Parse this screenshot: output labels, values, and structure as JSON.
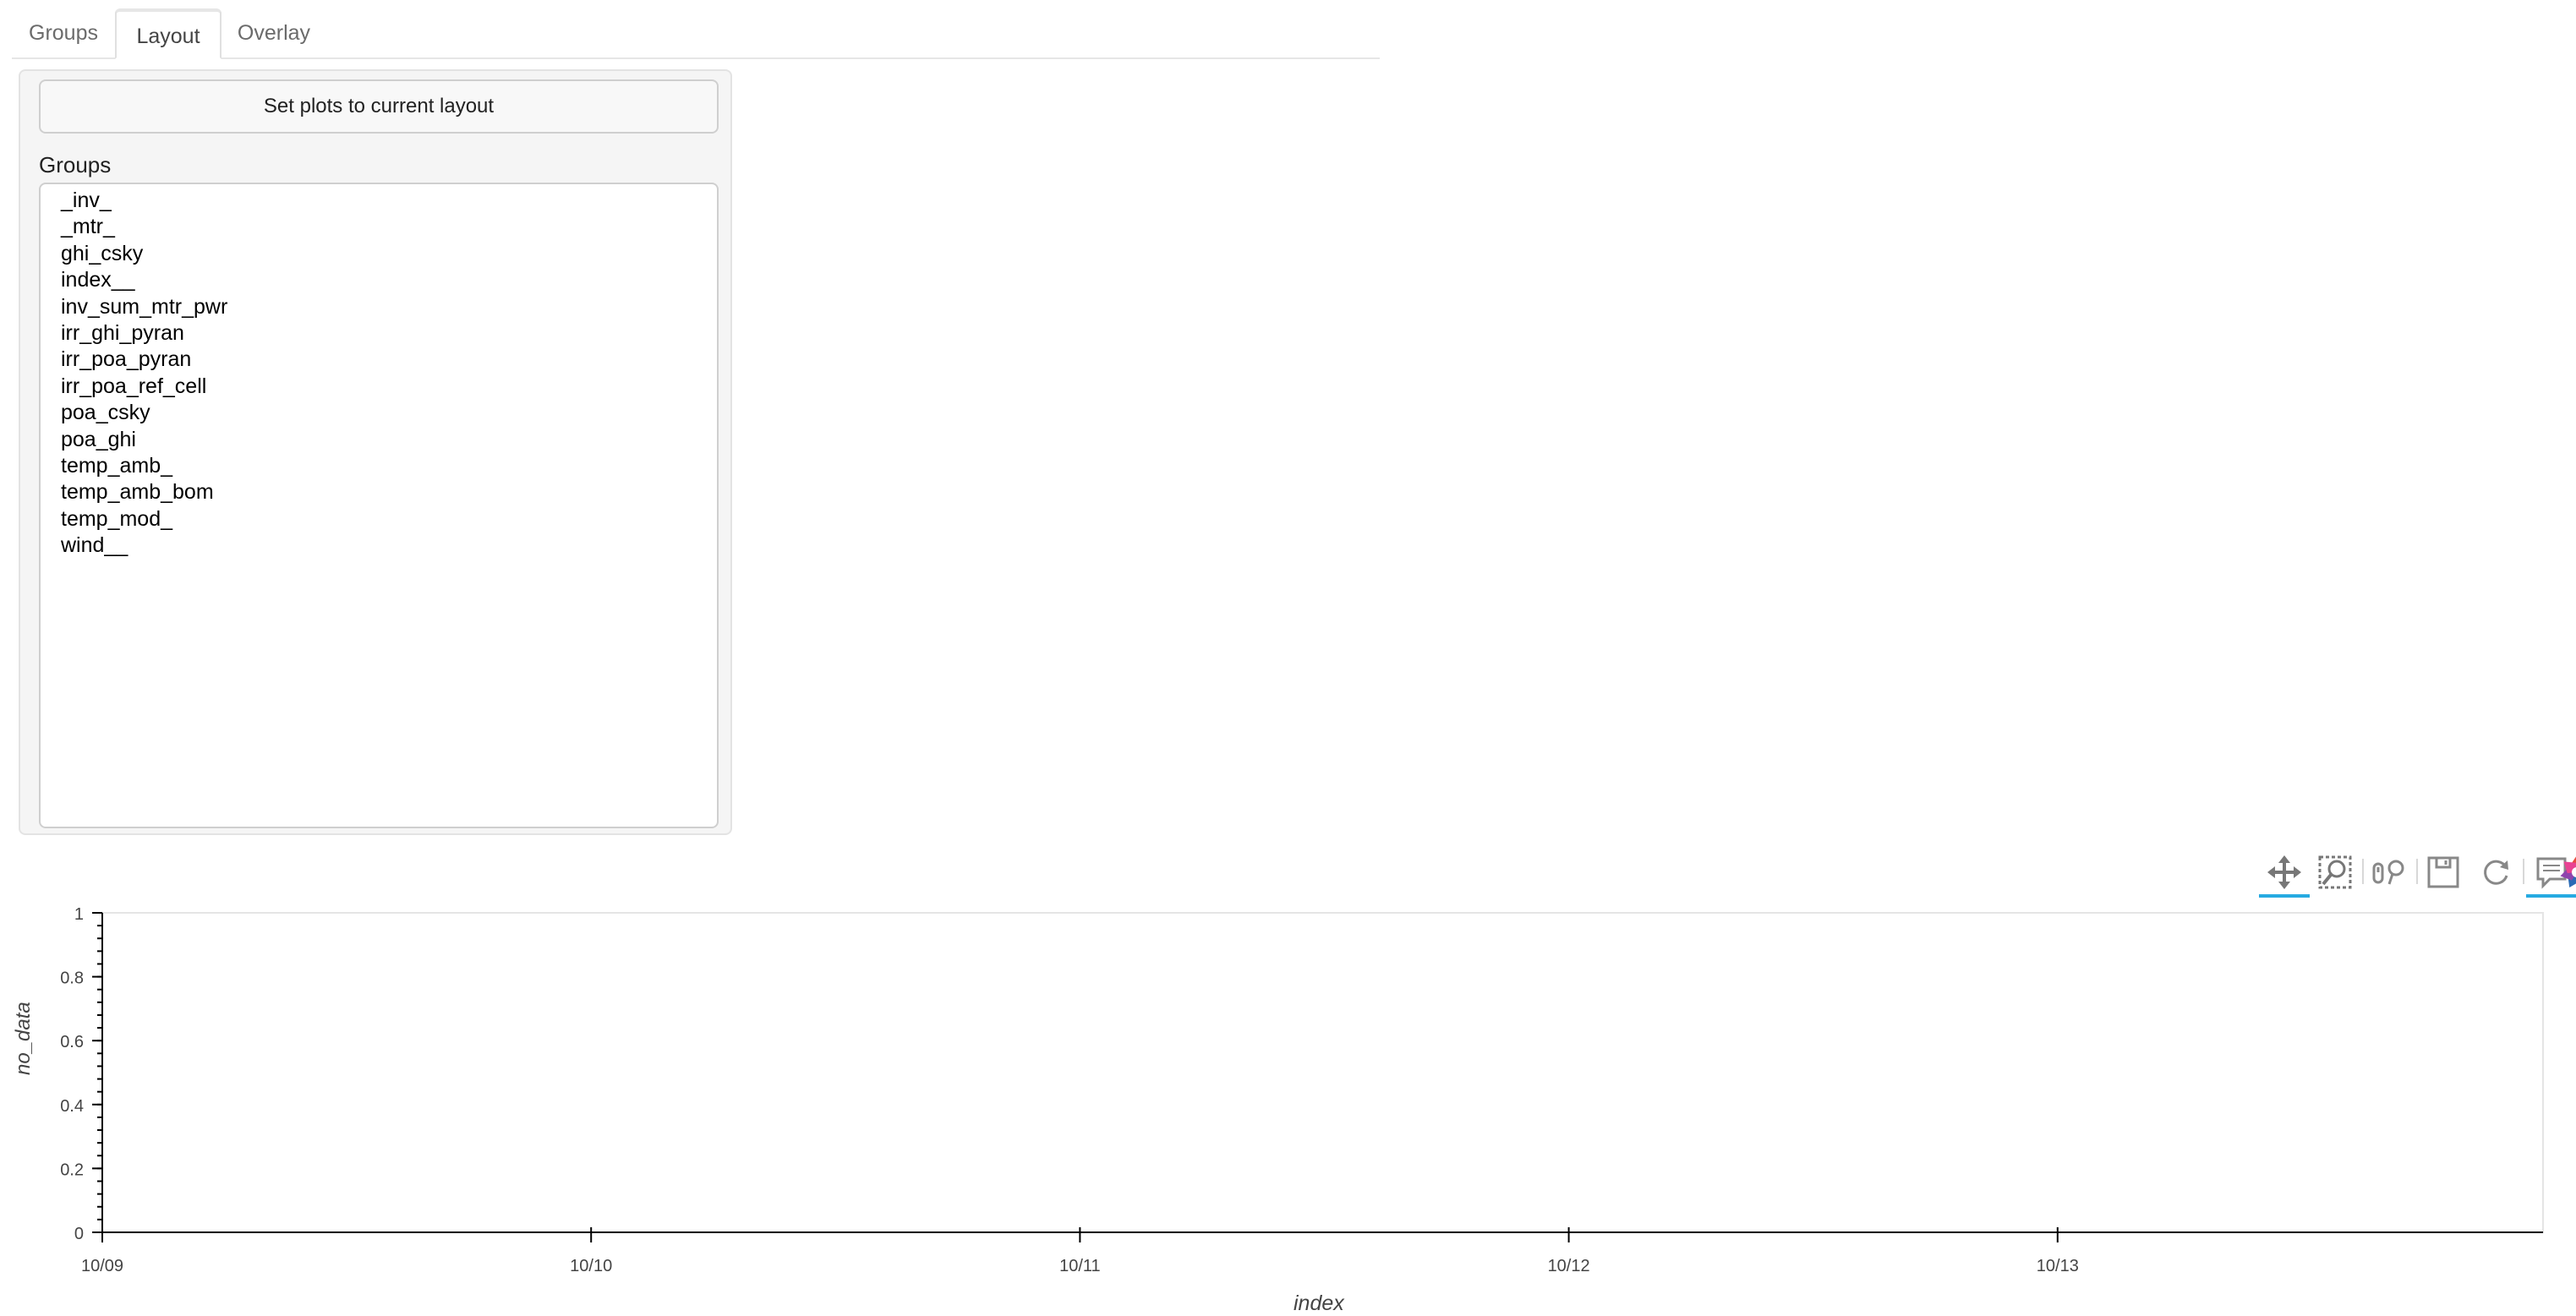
{
  "tabs": [
    {
      "label": "Groups",
      "active": false
    },
    {
      "label": "Layout",
      "active": true
    },
    {
      "label": "Overlay",
      "active": false
    }
  ],
  "layout_panel": {
    "set_button_label": "Set plots to current layout",
    "groups_label": "Groups",
    "groups": [
      "_inv_",
      "_mtr_",
      "ghi_csky",
      "index__",
      "inv_sum_mtr_pwr",
      "irr_ghi_pyran",
      "irr_poa_pyran",
      "irr_poa_ref_cell",
      "poa_csky",
      "poa_ghi",
      "temp_amb_",
      "temp_amb_bom",
      "temp_mod_",
      "wind__"
    ]
  },
  "toolbar": {
    "tools": [
      {
        "icon": "pan-icon",
        "active": true
      },
      {
        "icon": "box-zoom-icon",
        "active": false
      },
      {
        "icon": "wheel-zoom-icon",
        "active": false
      },
      {
        "icon": "save-icon",
        "active": false
      },
      {
        "icon": "reset-icon",
        "active": false
      },
      {
        "icon": "hover-icon",
        "active": true
      },
      {
        "icon": "bokeh-logo-icon",
        "active": false
      }
    ],
    "accent_color": "#26aae1"
  },
  "chart_data": {
    "type": "line",
    "title": "",
    "xlabel": "index",
    "ylabel": "no_data",
    "x_tick_labels": [
      "10/09",
      "10/10",
      "10/11",
      "10/12",
      "10/13"
    ],
    "y_tick_labels": [
      "0",
      "0.2",
      "0.4",
      "0.6",
      "0.8",
      "1"
    ],
    "y_ticks": [
      0,
      0.2,
      0.4,
      0.6,
      0.8,
      1
    ],
    "ylim": [
      0,
      1
    ],
    "series": [],
    "grid": false
  }
}
